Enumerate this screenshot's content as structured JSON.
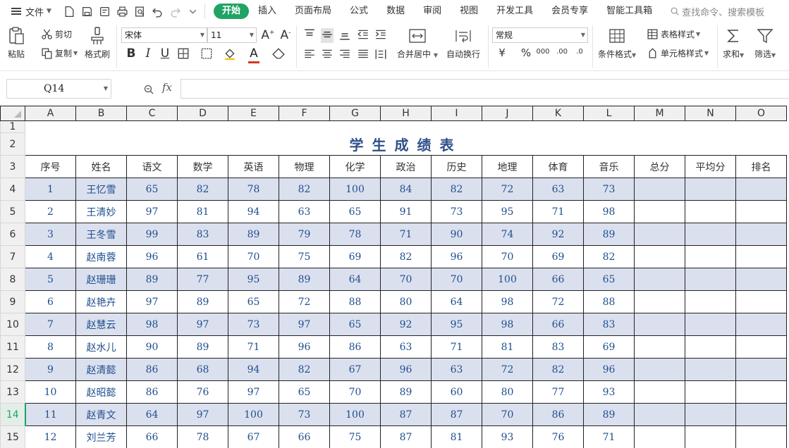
{
  "menu": {
    "file_label": "文件",
    "tabs": [
      "开始",
      "插入",
      "页面布局",
      "公式",
      "数据",
      "审阅",
      "视图",
      "开发工具",
      "会员专享",
      "智能工具箱"
    ],
    "search_placeholder": "查找命令、搜索模板"
  },
  "ribbon": {
    "paste": "粘贴",
    "cut": "剪切",
    "copy": "复制",
    "format_painter": "格式刷",
    "font_name": "宋体",
    "font_size": "11",
    "merge_center": "合并居中",
    "wrap_text": "自动换行",
    "number_format": "常规",
    "conditional_format": "条件格式",
    "table_style": "表格样式",
    "cell_style": "单元格样式",
    "sum": "求和",
    "filter": "筛选",
    "accent_color": "#21a366"
  },
  "formula_bar": {
    "cell_ref": "Q14",
    "fx_label": "fx",
    "formula": ""
  },
  "sheet": {
    "columns": [
      "A",
      "B",
      "C",
      "D",
      "E",
      "F",
      "G",
      "H",
      "I",
      "J",
      "K",
      "L",
      "M",
      "N",
      "O"
    ],
    "title": "学生成绩表",
    "headers": [
      "序号",
      "姓名",
      "语文",
      "数学",
      "英语",
      "物理",
      "化学",
      "政治",
      "历史",
      "地理",
      "体育",
      "音乐",
      "总分",
      "平均分",
      "排名"
    ],
    "selected_row": "14",
    "band_color": "#dbe0ef",
    "rows": [
      [
        "1",
        "王忆雪",
        "65",
        "82",
        "78",
        "82",
        "100",
        "84",
        "82",
        "72",
        "63",
        "73",
        "",
        "",
        ""
      ],
      [
        "2",
        "王清妙",
        "97",
        "81",
        "94",
        "63",
        "65",
        "91",
        "73",
        "95",
        "71",
        "98",
        "",
        "",
        ""
      ],
      [
        "3",
        "王冬雪",
        "99",
        "83",
        "89",
        "79",
        "78",
        "71",
        "90",
        "74",
        "92",
        "89",
        "",
        "",
        ""
      ],
      [
        "4",
        "赵南蓉",
        "96",
        "61",
        "70",
        "75",
        "69",
        "82",
        "96",
        "70",
        "69",
        "82",
        "",
        "",
        ""
      ],
      [
        "5",
        "赵珊珊",
        "89",
        "77",
        "95",
        "89",
        "64",
        "70",
        "70",
        "100",
        "66",
        "65",
        "",
        "",
        ""
      ],
      [
        "6",
        "赵艳卉",
        "97",
        "89",
        "65",
        "72",
        "88",
        "80",
        "64",
        "98",
        "72",
        "88",
        "",
        "",
        ""
      ],
      [
        "7",
        "赵慧云",
        "98",
        "97",
        "73",
        "97",
        "65",
        "92",
        "95",
        "98",
        "66",
        "83",
        "",
        "",
        ""
      ],
      [
        "8",
        "赵水儿",
        "90",
        "89",
        "71",
        "96",
        "86",
        "63",
        "71",
        "81",
        "83",
        "69",
        "",
        "",
        ""
      ],
      [
        "9",
        "赵清懿",
        "86",
        "68",
        "94",
        "82",
        "67",
        "96",
        "63",
        "72",
        "82",
        "96",
        "",
        "",
        ""
      ],
      [
        "10",
        "赵昭懿",
        "86",
        "76",
        "97",
        "65",
        "70",
        "89",
        "60",
        "80",
        "77",
        "93",
        "",
        "",
        ""
      ],
      [
        "11",
        "赵青文",
        "64",
        "97",
        "100",
        "73",
        "100",
        "87",
        "87",
        "70",
        "86",
        "89",
        "",
        "",
        ""
      ],
      [
        "12",
        "刘兰芳",
        "66",
        "78",
        "67",
        "66",
        "75",
        "87",
        "81",
        "93",
        "76",
        "71",
        "",
        "",
        ""
      ]
    ]
  }
}
